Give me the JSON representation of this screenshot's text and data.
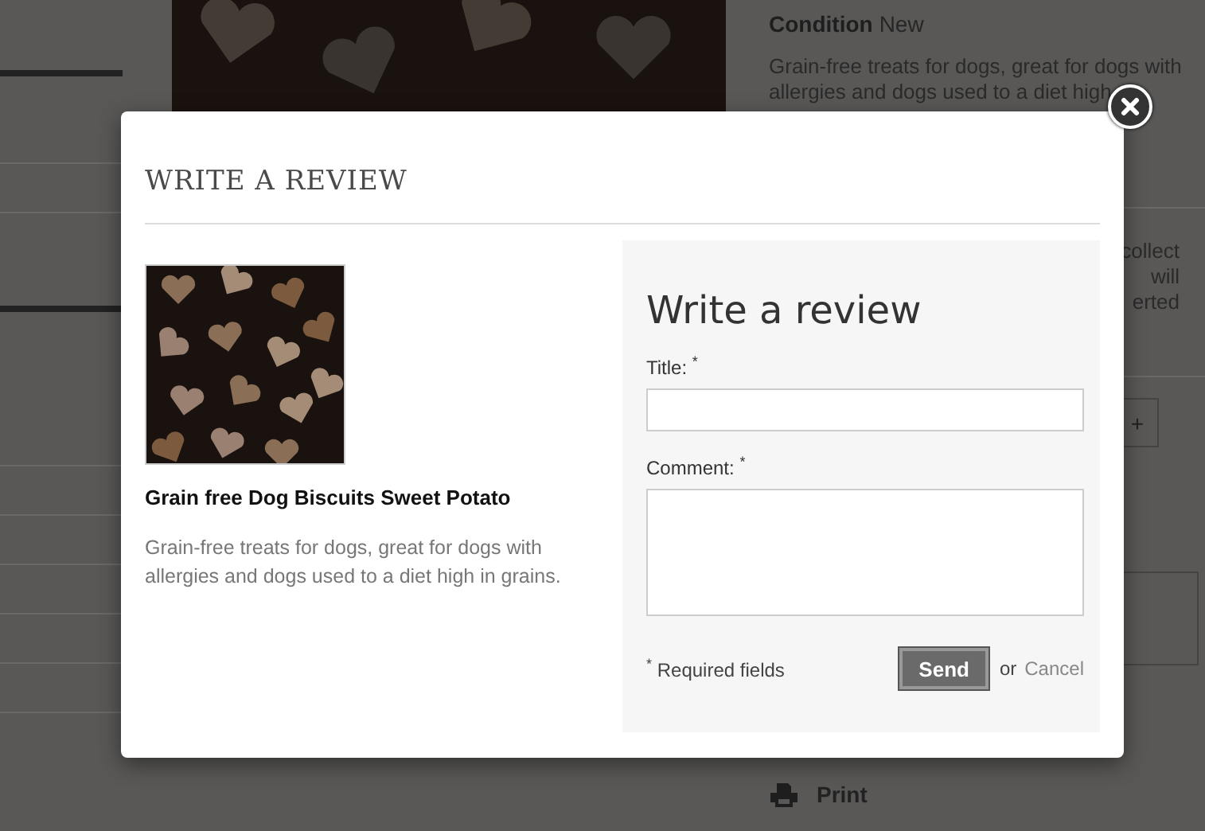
{
  "background": {
    "condition_label": "Condition",
    "condition_value": "New",
    "description_lines": [
      "Grain-free treats for dogs, great for dogs with",
      "allergies and dogs used to a diet high"
    ],
    "fragment_lines": [
      "collect",
      "will",
      "erted"
    ],
    "stepper": "+",
    "print_link": "Print"
  },
  "modal": {
    "heading": "WRITE A REVIEW",
    "product": {
      "name": "Grain free Dog Biscuits Sweet Potato",
      "description": "Grain-free treats for dogs, great for dogs with allergies and dogs used to a diet high in grains."
    },
    "form": {
      "title": "Write a review",
      "fields": [
        {
          "kind": "line",
          "label": "Title:",
          "required_mark": "*"
        },
        {
          "kind": "area",
          "label": "Comment:",
          "required_mark": "*"
        }
      ],
      "required_mark": "*",
      "required_note": "Required fields",
      "send_button": "Send",
      "or_text": "or",
      "cancel_link": "Cancel"
    }
  }
}
